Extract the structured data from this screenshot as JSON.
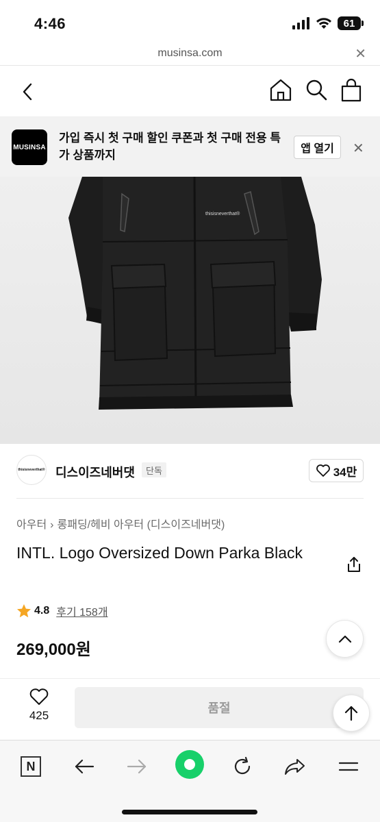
{
  "status_bar": {
    "time": "4:46",
    "battery": "61"
  },
  "browser": {
    "url": "musinsa.com"
  },
  "app_banner": {
    "logo_text": "MUSINSA",
    "message": "가입 즉시 첫 구매 할인 쿠폰과 첫 구매 전용 특가 상품까지",
    "open_app_label": "앱 열기"
  },
  "product_image": {
    "brand_print": "thisisneverthat®"
  },
  "brand": {
    "avatar_text": "thisisneverthat®",
    "name": "디스이즈네버댓",
    "badge": "단독",
    "likes": "34만"
  },
  "breadcrumb": [
    "아우터",
    "롱패딩/헤비 아우터 (디스이즈네버댓)"
  ],
  "product": {
    "title": "INTL. Logo Oversized Down Parka Black",
    "rating": "4.8",
    "reviews_label": "후기 158개",
    "price": "269,000원"
  },
  "purchase_bar": {
    "wish_count": "425",
    "soldout_label": "품절"
  },
  "browser_bar": {
    "n_label": "N"
  }
}
